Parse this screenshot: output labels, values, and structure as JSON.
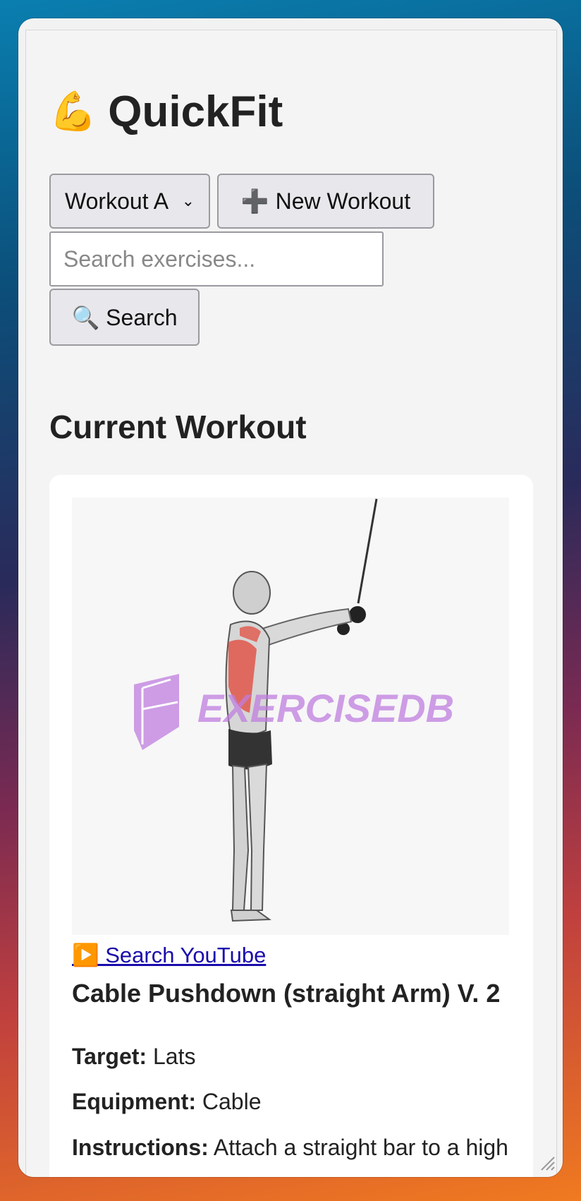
{
  "app": {
    "title": "QuickFit",
    "title_emoji": "💪"
  },
  "controls": {
    "workout_select": {
      "selected": "Workout A",
      "chevron": "⌄"
    },
    "new_workout_label": "➕ New Workout",
    "search_placeholder": "Search exercises...",
    "search_button_label": "🔍 Search"
  },
  "current_workout": {
    "heading": "Current Workout",
    "exercise": {
      "image_watermark": "EXERCISEDB",
      "youtube_link_label": "▶️ Search YouTube",
      "name": "Cable Pushdown (straight Arm) V. 2",
      "target_label": "Target:",
      "target_value": "Lats",
      "equipment_label": "Equipment:",
      "equipment_value": "Cable",
      "instructions_label": "Instructions:",
      "instructions_value": "Attach a straight bar to a high"
    }
  },
  "colors": {
    "link": "#1a0dab",
    "watermark": "#c07ee0",
    "muscle_highlight": "#e0564a"
  }
}
